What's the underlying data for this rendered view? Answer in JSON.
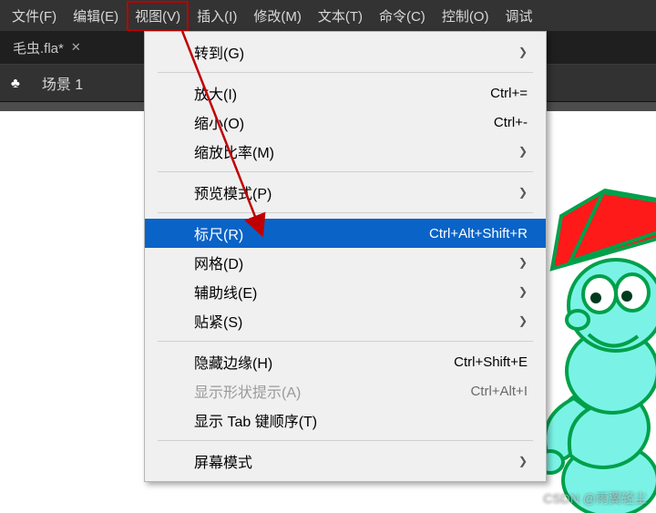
{
  "menubar": {
    "items": [
      {
        "label": "文件(F)"
      },
      {
        "label": "编辑(E)"
      },
      {
        "label": "视图(V)",
        "active": true
      },
      {
        "label": "插入(I)"
      },
      {
        "label": "修改(M)"
      },
      {
        "label": "文本(T)"
      },
      {
        "label": "命令(C)"
      },
      {
        "label": "控制(O)"
      },
      {
        "label": "调试"
      }
    ]
  },
  "tabbar": {
    "filename": "毛虫.fla*",
    "close_glyph": "✕"
  },
  "scenebar": {
    "icon": "♣",
    "label": "场景 1"
  },
  "dropdown": {
    "groups": [
      [
        {
          "label": "转到(G)",
          "submenu": true
        }
      ],
      [
        {
          "label": "放大(I)",
          "shortcut": "Ctrl+="
        },
        {
          "label": "缩小(O)",
          "shortcut": "Ctrl+-"
        },
        {
          "label": "缩放比率(M)",
          "submenu": true
        }
      ],
      [
        {
          "label": "预览模式(P)",
          "submenu": true
        }
      ],
      [
        {
          "label": "标尺(R)",
          "shortcut": "Ctrl+Alt+Shift+R",
          "highlight": true
        },
        {
          "label": "网格(D)",
          "submenu": true
        },
        {
          "label": "辅助线(E)",
          "submenu": true
        },
        {
          "label": "贴紧(S)",
          "submenu": true
        }
      ],
      [
        {
          "label": "隐藏边缘(H)",
          "shortcut": "Ctrl+Shift+E"
        },
        {
          "label": "显示形状提示(A)",
          "shortcut": "Ctrl+Alt+I",
          "disabled": true
        },
        {
          "label": "显示 Tab 键顺序(T)"
        }
      ],
      [
        {
          "label": "屏幕模式",
          "submenu": true
        }
      ]
    ],
    "arrow_glyph": "❯"
  },
  "colors": {
    "highlight_bg": "#0a63c7",
    "annotation": "#c00000",
    "menu_outline": "#b80000",
    "character_body": "#7af3e6",
    "character_outline": "#00a04a",
    "character_hat": "#ff1a1a"
  },
  "watermark": "CSDN @雨翼轻尘"
}
